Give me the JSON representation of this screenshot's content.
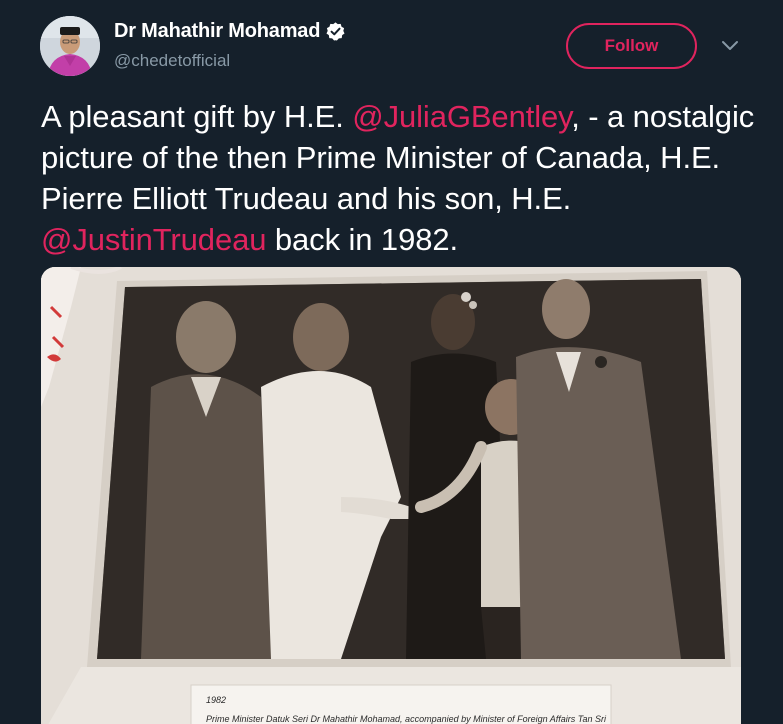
{
  "author": {
    "name": "Dr Mahathir Mohamad",
    "handle": "@chedetofficial",
    "verified": true,
    "avatar_icon": "avatar-portrait"
  },
  "actions": {
    "follow_label": "Follow",
    "menu_icon": "chevron-down-icon"
  },
  "tweet": {
    "text_before_mention_1": "A pleasant gift by H.E. ",
    "mention_1": "@JuliaGBentley",
    "text_between": ", - a nostalgic picture of the then Prime Minister of Canada, H.E. Pierre Elliott Trudeau and his son, H.E. ",
    "mention_2": "@JustinTrudeau",
    "text_after": " back in 1982."
  },
  "media": {
    "caption_year": "1982",
    "caption_text": "Prime Minister Datuk Seri Dr Mahathir Mohamad, accompanied by Minister of Foreign Affairs Tan Sri"
  },
  "colors": {
    "background": "#15202b",
    "accent": "#e0245e",
    "secondary_text": "#8899a6",
    "verified_badge": "#ffffff"
  }
}
